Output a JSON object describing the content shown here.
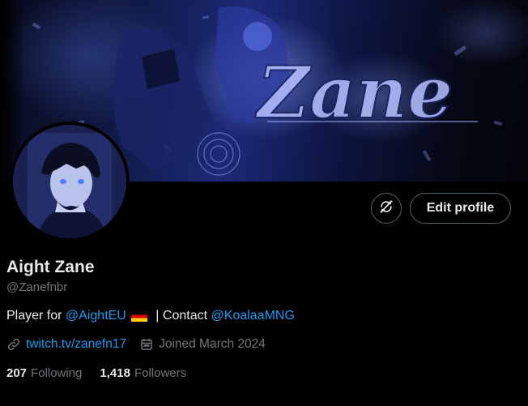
{
  "banner": {
    "artwork_text": "Zane",
    "image": "anime-art-banner"
  },
  "avatar": {
    "image": "anime-character-avatar"
  },
  "actions": {
    "icon_button_icon": "retweet-slash-icon",
    "edit_profile_label": "Edit profile"
  },
  "profile": {
    "display_name": "Aight Zane",
    "handle": "@Zanefnbr",
    "bio": {
      "prefix": "Player for ",
      "team_link": "@AightEU",
      "flag": "germany-flag",
      "middle": " | Contact ",
      "contact_link": "@KoalaaMNG"
    },
    "website": "twitch.tv/zanefn17",
    "joined": "Joined March 2024"
  },
  "stats": {
    "following_count": "207",
    "following_label": "Following",
    "followers_count": "1,418",
    "followers_label": "Followers"
  },
  "colors": {
    "background": "#000000",
    "text_primary": "#e7e9ea",
    "text_secondary": "#71767b",
    "link": "#1d9bf0",
    "border": "#536471"
  }
}
